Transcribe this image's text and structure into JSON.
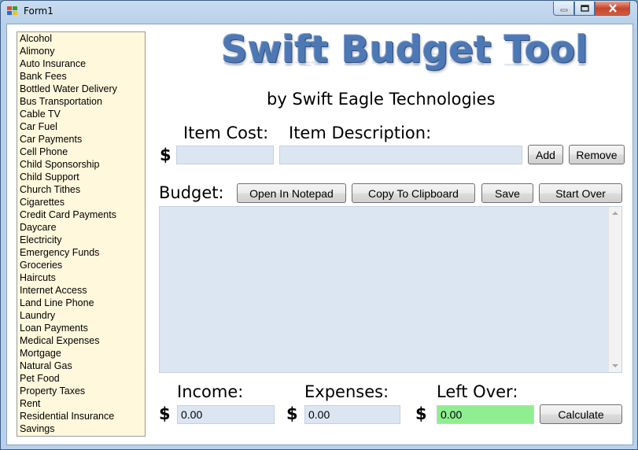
{
  "window": {
    "title": "Form1"
  },
  "categories": [
    "Alcohol",
    "Alimony",
    "Auto Insurance",
    "Bank Fees",
    "Bottled Water Delivery",
    "Bus Transportation",
    "Cable TV",
    "Car Fuel",
    "Car Payments",
    "Cell Phone",
    "Child Sponsorship",
    "Child Support",
    "Church Tithes",
    "Cigarettes",
    "Credit Card Payments",
    "Daycare",
    "Electricity",
    "Emergency Funds",
    "Groceries",
    "Haircuts",
    "Internet Access",
    "Land Line Phone",
    "Laundry",
    "Loan Payments",
    "Medical Expenses",
    "Mortgage",
    "Natural Gas",
    "Pet Food",
    "Property Taxes",
    "Rent",
    "Residential Insurance",
    "Savings"
  ],
  "header": {
    "logo": "Swift Budget Tool",
    "subtitle": "by Swift Eagle Technologies"
  },
  "item": {
    "cost_label": "Item Cost:",
    "description_label": "Item Description:",
    "currency": "$",
    "cost_value": "",
    "description_value": "",
    "add_label": "Add",
    "remove_label": "Remove"
  },
  "budget": {
    "label": "Budget:",
    "open_notepad_label": "Open In Notepad",
    "copy_clipboard_label": "Copy To Clipboard",
    "save_label": "Save",
    "start_over_label": "Start Over",
    "text": ""
  },
  "summary": {
    "income_label": "Income:",
    "expenses_label": "Expenses:",
    "left_over_label": "Left Over:",
    "currency": "$",
    "income_value": "0.00",
    "expenses_value": "0.00",
    "left_over_value": "0.00",
    "calculate_label": "Calculate"
  },
  "colors": {
    "listbox_background": "#fff8dc",
    "textbox_background": "#dbe6f2",
    "left_over_background": "#90ee90",
    "logo_color": "#4d78b4"
  }
}
